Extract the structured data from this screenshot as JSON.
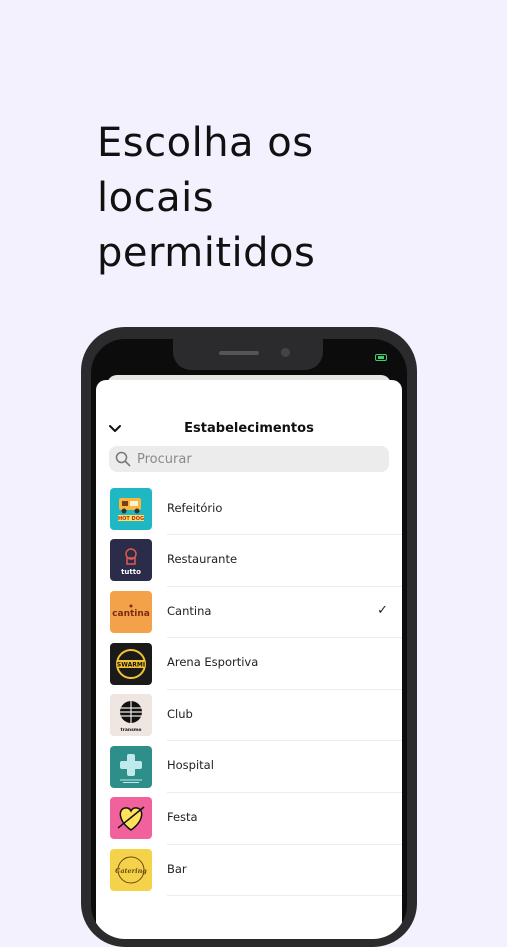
{
  "headline": {
    "lines": [
      "Escolha os",
      "locais",
      "permitidos"
    ]
  },
  "sheet": {
    "title": "Estabelecimentos",
    "search_placeholder": "Procurar"
  },
  "items": [
    {
      "label": "Refeitório",
      "logo_text": "HOT DOG",
      "logo_bg": "#1fb7c4",
      "icon": "food-truck-icon",
      "selected": false
    },
    {
      "label": "Restaurante",
      "logo_text": "tutto",
      "logo_bg": "#2a2c4a",
      "icon": "chef-icon",
      "selected": false
    },
    {
      "label": "Cantina",
      "logo_text": "cantina",
      "logo_bg": "#f4a24a",
      "icon": "cantina-logo",
      "selected": true
    },
    {
      "label": "Arena Esportiva",
      "logo_text": "SWARMI",
      "logo_bg": "#1a1a1a",
      "icon": "arena-badge-icon",
      "selected": false
    },
    {
      "label": "Club",
      "logo_text": "transmo",
      "logo_bg": "#efe6e2",
      "icon": "club-ball-icon",
      "selected": false
    },
    {
      "label": "Hospital",
      "logo_text": "",
      "logo_bg": "#2e8f8a",
      "icon": "medical-cross-icon",
      "selected": false
    },
    {
      "label": "Festa",
      "logo_text": "",
      "logo_bg": "#f1619c",
      "icon": "heart-icon",
      "selected": false
    },
    {
      "label": "Bar",
      "logo_text": "Catering",
      "logo_bg": "#f4d34a",
      "icon": "bar-logo",
      "selected": false
    }
  ],
  "check_symbol": "✓"
}
